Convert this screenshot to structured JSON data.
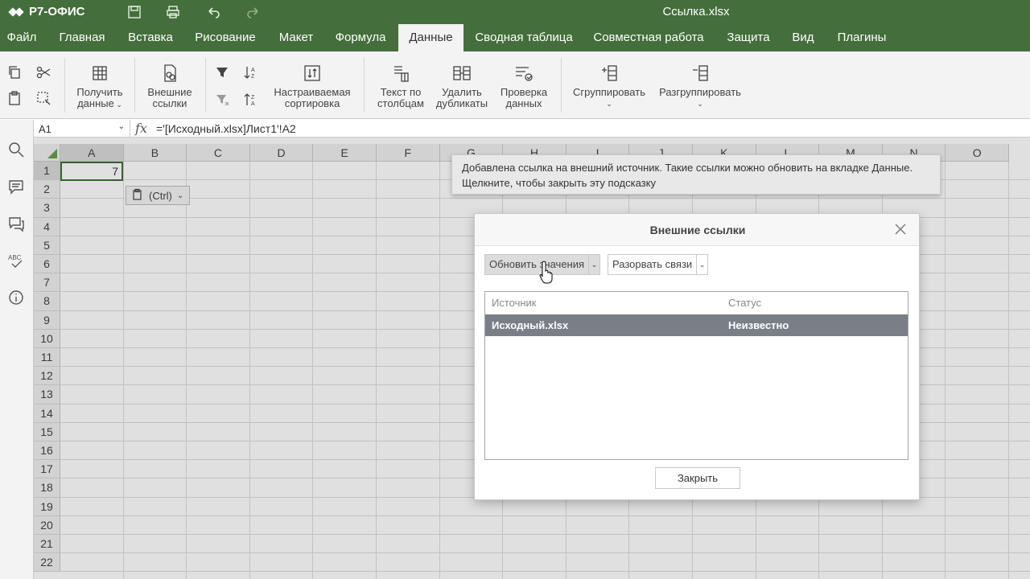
{
  "app": {
    "brand": "Р7-ОФИС",
    "document_title": "Ссылка.xlsx"
  },
  "menu": {
    "tabs": [
      "Файл",
      "Главная",
      "Вставка",
      "Рисование",
      "Макет",
      "Формула",
      "Данные",
      "Сводная таблица",
      "Совместная работа",
      "Защита",
      "Вид",
      "Плагины"
    ],
    "active": "Данные"
  },
  "toolbar": {
    "get_data": [
      "Получить",
      "данные"
    ],
    "external_links": [
      "Внешние",
      "ссылки"
    ],
    "custom_sort": [
      "Настраиваемая",
      "сортировка"
    ],
    "text_to_columns": [
      "Текст по",
      "столбцам"
    ],
    "remove_duplicates": [
      "Удалить",
      "дубликаты"
    ],
    "data_validation": [
      "Проверка",
      "данных"
    ],
    "group": "Сгруппировать",
    "ungroup": "Разгруппировать"
  },
  "formula_bar": {
    "cell_ref": "A1",
    "fx": "fx",
    "formula": "='[Исходный.xlsx]Лист1'!A2"
  },
  "grid": {
    "columns": [
      "A",
      "B",
      "C",
      "D",
      "E",
      "F",
      "G",
      "H",
      "I",
      "J",
      "K",
      "L",
      "M",
      "N",
      "O"
    ],
    "rows": [
      "1",
      "2",
      "3",
      "4",
      "5",
      "6",
      "7",
      "8",
      "9",
      "10",
      "11",
      "12",
      "13",
      "14",
      "15",
      "16",
      "17",
      "18",
      "19",
      "20",
      "21",
      "22"
    ],
    "selected_cell": "A1",
    "a1_value": "7",
    "paste_options": "(Ctrl)"
  },
  "tooltip": {
    "line1": "Добавлена ссылка на внешний источник. Такие ссылки можно обновить на вкладке Данные.",
    "line2": "Щелкните, чтобы закрыть эту подсказку"
  },
  "dialog": {
    "title": "Внешние ссылки",
    "update_values": "Обновить значения",
    "break_links": "Разорвать связи",
    "col_source": "Источник",
    "col_status": "Статус",
    "rows": [
      {
        "source": "Исходный.xlsx",
        "status": "Неизвестно"
      }
    ],
    "close": "Закрыть"
  },
  "colors": {
    "brand_green": "#446e3b",
    "selected_row": "#7a7e86"
  }
}
